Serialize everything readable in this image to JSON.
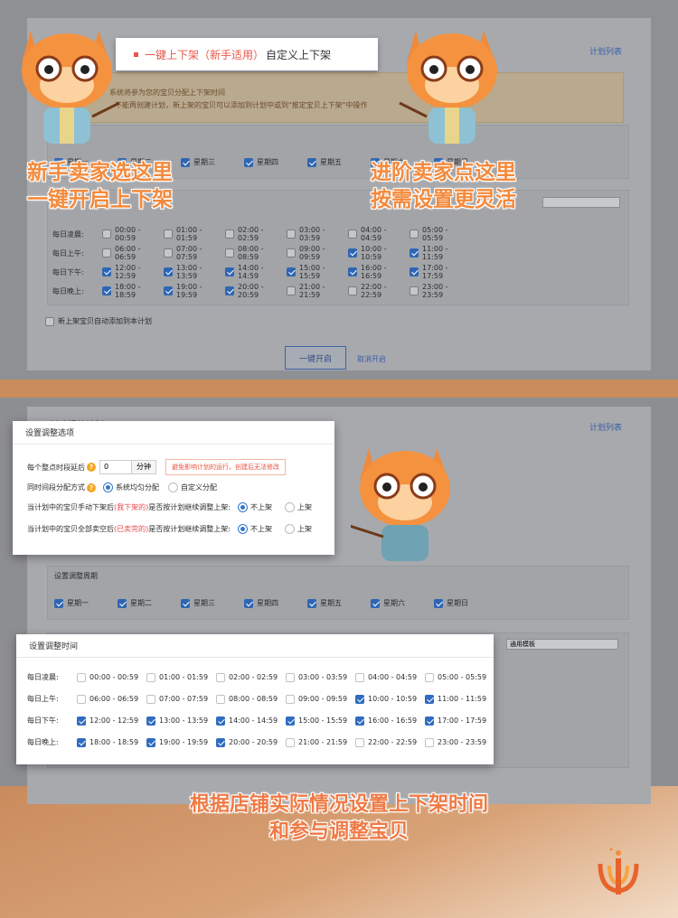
{
  "tabs": {
    "beginner": "一键上下架（新手适用）",
    "custom": "自定义上下架"
  },
  "plan_list_link": "计划列表",
  "notice": {
    "line1": "系统将参为您的宝贝分配上下架时间",
    "line2": "不能再创建计划，新上架的宝贝可以添加到计划中或到\"推定宝贝上下架\"中操作"
  },
  "weekdays": [
    "星期一",
    "星期二",
    "星期三",
    "星期四",
    "星期五",
    "星期六",
    "星期日"
  ],
  "time_rows": [
    {
      "label": "每日凌晨:",
      "slots": [
        "00:00 - 00:59",
        "01:00 - 01:59",
        "02:00 - 02:59",
        "03:00 - 03:59",
        "04:00 - 04:59",
        "05:00 - 05:59"
      ],
      "checked": [
        false,
        false,
        false,
        false,
        false,
        false
      ]
    },
    {
      "label": "每日上午:",
      "slots": [
        "06:00 - 06:59",
        "07:00 - 07:59",
        "08:00 - 08:59",
        "09:00 - 09:59",
        "10:00 - 10:59",
        "11:00 - 11:59"
      ],
      "checked": [
        false,
        false,
        false,
        false,
        true,
        true
      ]
    },
    {
      "label": "每日下午:",
      "slots": [
        "12:00 - 12:59",
        "13:00 - 13:59",
        "14:00 - 14:59",
        "15:00 - 15:59",
        "16:00 - 16:59",
        "17:00 - 17:59"
      ],
      "checked": [
        true,
        true,
        true,
        true,
        true,
        true
      ]
    },
    {
      "label": "每日晚上:",
      "slots": [
        "18:00 - 18:59",
        "19:00 - 19:59",
        "20:00 - 20:59",
        "21:00 - 21:59",
        "22:00 - 22:59",
        "23:00 - 23:59"
      ],
      "checked": [
        true,
        true,
        true,
        false,
        false,
        false
      ]
    }
  ],
  "auto_add_label": "新上架宝贝自动添加到本计划",
  "primary_button": "一键开启",
  "cancel_link": "取消开启",
  "callouts": {
    "left_line1": "新手卖家选这里",
    "left_line2": "一键开启上下架",
    "right_line1": "进阶卖家点这里",
    "right_line2": "按需设置更灵活",
    "bottom_line1": "根据店铺实际情况设置上下架时间",
    "bottom_line2": "和参与调整宝贝"
  },
  "panel2": {
    "title": "新建调整计划",
    "plan_list_link": "计划列表",
    "template_select": "通用模板"
  },
  "options_card": {
    "title": "设置调整选项",
    "delay_label": "每个整点时段延后",
    "delay_value": "0",
    "delay_unit": "分钟",
    "delay_hint": "避免影响计划的运行，创建后无法修改",
    "method_label": "同时间段分配方式",
    "method_system": "系统均匀分配",
    "method_custom": "自定义分配",
    "q1_prefix": "当计划中的宝贝手动下架后",
    "q1_red": "(我下架的)",
    "q1_suffix": "是否按计划继续调整上架:",
    "q2_prefix": "当计划中的宝贝全部卖空后",
    "q2_red": "(已卖完的)",
    "q2_suffix": "是否按计划继续调整上架:",
    "opt_no": "不上架",
    "opt_yes": "上架",
    "q_mark": "?"
  },
  "cycle_box_title": "设置调整周期",
  "time_card_title": "设置调整时间",
  "colors": {
    "accent": "#f48a3c",
    "blue": "#2f6cc2",
    "red": "#e84a4a"
  }
}
